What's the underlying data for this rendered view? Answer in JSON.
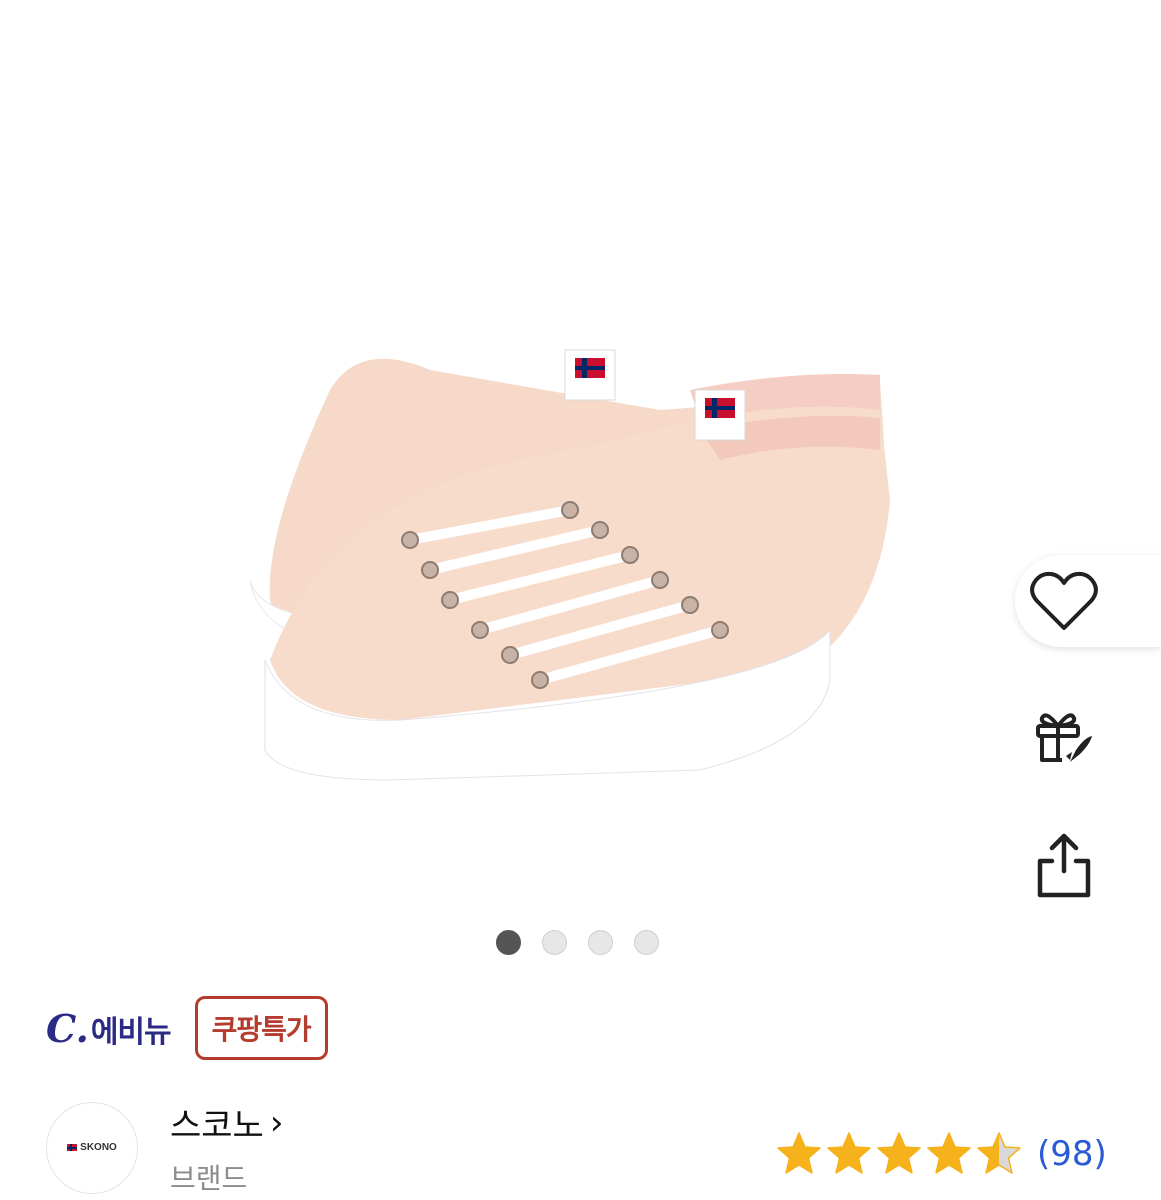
{
  "carousel": {
    "total_images": 4,
    "active_index": 0
  },
  "actions": {
    "wishlist_icon": "heart-icon",
    "gift_icon": "gift-rocket-icon",
    "share_icon": "share-icon"
  },
  "seller": {
    "logo_mark": "C.",
    "name": "에비뉴",
    "deal_badge": "쿠팡특가",
    "logo_color": "#2b2a84",
    "badge_color": "#b43b2e"
  },
  "brand": {
    "logo_text": "SKONO",
    "name": "스코노",
    "chevron": "›",
    "label": "브랜드"
  },
  "rating": {
    "stars": 4.5,
    "max_stars": 5,
    "review_count": "(98)",
    "star_color": "#f5b21a",
    "count_color": "#2a5bd7"
  }
}
